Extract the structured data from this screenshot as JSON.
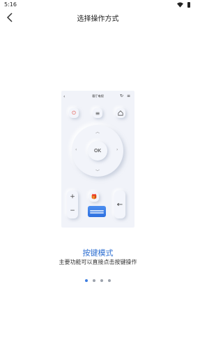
{
  "status_bar": {
    "time": "5:16",
    "icons": [
      "wifi-icon",
      "battery-icon"
    ]
  },
  "header": {
    "title": "选择操作方式",
    "back_icon": "chevron-left-icon"
  },
  "preview": {
    "title": "客厅电视",
    "back_icon": "chevron-left-icon",
    "top_icons": [
      "refresh-icon",
      "settings-icon"
    ],
    "buttons": {
      "power_icon": "power-icon",
      "menu_icon": "menu-icon",
      "home_icon": "home-icon"
    },
    "dpad": {
      "ok": "OK"
    },
    "volume": {
      "plus": "+",
      "minus": "−"
    },
    "promo_icon": "gift-icon",
    "back_key_icon": "arrow-left-icon"
  },
  "mode": {
    "title": "按键模式",
    "description": "主要功能可以直接点击按键操作"
  },
  "pager": {
    "count": 4,
    "active": 0
  },
  "colors": {
    "accent": "#2e6fd1",
    "power": "#e24a3d"
  }
}
